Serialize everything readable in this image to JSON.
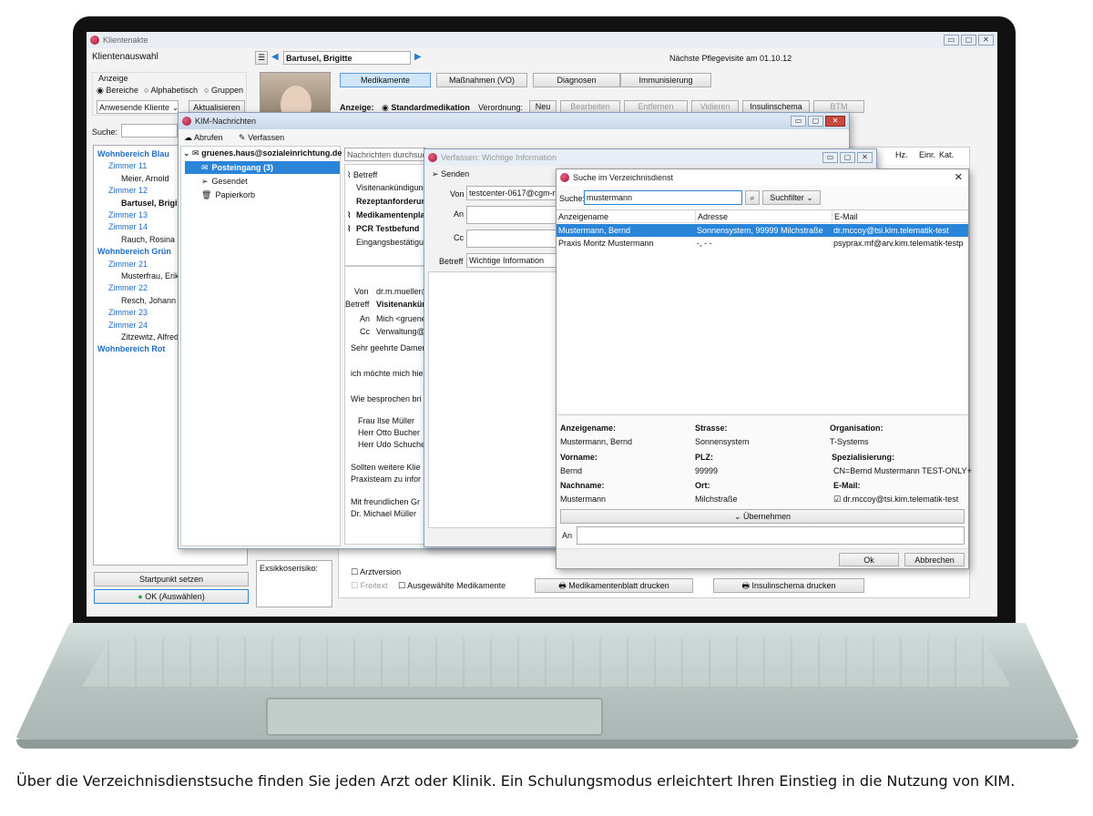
{
  "caption": "Über die Verzeichnisdienstsuche finden Sie jeden Arzt oder Klinik. Ein Schulungsmodus erleichtert Ihren Einstieg in die Nutzung von KIM.",
  "main": {
    "title": "Klientenakte",
    "client_select_label": "Klientenauswahl",
    "client_name": "Bartusel, Brigitte",
    "next_visit": "Nächste Pflegevisite am 01.10.12",
    "anzeige_label": "Anzeige",
    "radio_bereiche": "Bereiche",
    "radio_alphabetisch": "Alphabetisch",
    "radio_gruppen": "Gruppen",
    "filter_value": "Anwesende Kliente",
    "refresh_label": "Aktualisieren",
    "search_label": "Suche:",
    "tree": [
      {
        "text": "Wohnbereich Blau",
        "level": 0
      },
      {
        "text": "Zimmer 11",
        "level": 1
      },
      {
        "text": "Meier, Arnold",
        "level": 2
      },
      {
        "text": "Zimmer 12",
        "level": 1
      },
      {
        "text": "Bartusel, Brigitte",
        "level": 2,
        "bold": true
      },
      {
        "text": "Zimmer 13",
        "level": 1
      },
      {
        "text": "Zimmer 14",
        "level": 1
      },
      {
        "text": "Rauch, Rosina",
        "level": 2
      },
      {
        "text": "Wohnbereich Grün",
        "level": 0
      },
      {
        "text": "Zimmer 21",
        "level": 1
      },
      {
        "text": "Musterfrau, Erika",
        "level": 2
      },
      {
        "text": "Zimmer 22",
        "level": 1
      },
      {
        "text": "Resch, Johann",
        "level": 2
      },
      {
        "text": "Zimmer 23",
        "level": 1
      },
      {
        "text": "Zimmer 24",
        "level": 1
      },
      {
        "text": "Zitzewitz, Alfred",
        "level": 2
      },
      {
        "text": "Wohnbereich Rot",
        "level": 0
      }
    ],
    "startpunkt": "Startpunkt setzen",
    "ok_select": "OK (Auswählen)",
    "tabs": [
      "Medikamente",
      "Maßnahmen (VO)",
      "Diagnosen",
      "Immunisierung"
    ],
    "anzeige_row_label": "Anzeige:",
    "standardmedikation": "Standardmedikation",
    "verordnung_label": "Verordnung:",
    "action_buttons": [
      "Neu",
      "Bearbeiten",
      "Entfernen",
      "Vidieren",
      "Insulinschema",
      "BTM"
    ],
    "col_hz": "Hz.",
    "col_einr": "Einr.",
    "col_kat": "Kat.",
    "exsikkose": "Exsikkoserisiko:",
    "arztversion": "Arztversion",
    "freitext": "Freitext",
    "ausgewaehlte": "Ausgewählte Medikamente",
    "medikamentenblatt": "Medikamentenblatt drucken",
    "insulinschema_drucken": "Insulinschema drucken"
  },
  "kim": {
    "title": "KIM-Nachrichten",
    "abrufen": "Abrufen",
    "verfassen": "Verfassen",
    "account": "gruenes.haus@sozialeinrichtung.de",
    "folders": [
      "Posteingang (3)",
      "Gesendet",
      "Papierkorb"
    ],
    "search_placeholder": "Nachrichten durchsuchen",
    "list_header": "Betreff",
    "messages": [
      {
        "text": "Visitenankündigung",
        "bold": false,
        "attach": false
      },
      {
        "text": "Rezeptanforderung",
        "bold": true,
        "attach": false
      },
      {
        "text": "Medikamentenplan",
        "bold": true,
        "attach": true
      },
      {
        "text": "PCR Testbefund",
        "bold": true,
        "attach": true
      },
      {
        "text": "Eingangsbestätigung",
        "bold": false,
        "attach": false
      }
    ],
    "detail_von_label": "Von",
    "detail_von": "dr.m.mueller@",
    "detail_betreff_label": "Betreff",
    "detail_betreff": "Visitenankündigung",
    "detail_an_label": "An",
    "detail_an": "Mich <gruenes",
    "detail_cc_label": "Cc",
    "detail_cc": "Verwaltung@s",
    "body": [
      "Sehr geehrte Damen",
      "ich möchte mich hie",
      "Wie besprochen bri",
      "Frau Ilse Müller",
      "Herr Otto Bucher",
      "Herr Udo Schuche",
      "Sollten weitere Klie",
      "Praxisteam zu infor",
      "Mit freundlichen Gr",
      "Dr. Michael Müller"
    ]
  },
  "compose": {
    "title": "Verfassen: Wichtige Information",
    "senden": "Senden",
    "von_label": "Von",
    "von_value": "testcenter-0617@cgm-r",
    "an_label": "An",
    "cc_label": "Cc",
    "betreff_label": "Betreff",
    "betreff_value": "Wichtige Information"
  },
  "directory": {
    "title": "Suche im Verzeichnisdienst",
    "search_label": "Suche:",
    "search_value": "mustermann",
    "filter_label": "Suchfilter",
    "columns": [
      "Anzeigename",
      "Adresse",
      "E-Mail"
    ],
    "rows": [
      {
        "name": "Mustermann, Bernd",
        "address": "Sonnensystem, 99999 Milchstraße",
        "email": "dr.mccoy@tsi.kim.telematik-test",
        "selected": true
      },
      {
        "name": "Praxis Moritz Mustermann",
        "address": "-, - -",
        "email": "psyprax.mf@arv.kim.telematik-testp",
        "selected": false
      }
    ],
    "details": {
      "anzeigename_label": "Anzeigename:",
      "anzeigename": "Mustermann, Bernd",
      "strasse_label": "Strasse:",
      "strasse": "Sonnensystem",
      "organisation_label": "Organisation:",
      "organisation": "T-Systems",
      "vorname_label": "Vorname:",
      "vorname": "Bernd",
      "plz_label": "PLZ:",
      "plz": "99999",
      "spezialisierung_label": "Spezialisierung:",
      "spezialisierung": "CN=Bernd Mustermann TEST-ONLY+",
      "nachname_label": "Nachname:",
      "nachname": "Mustermann",
      "ort_label": "Ort:",
      "ort": "Milchstraße",
      "email_label": "E-Mail:",
      "email": "dr.mccoy@tsi.kim.telematik-test"
    },
    "uebernehmen": "Übernehmen",
    "an_label": "An",
    "ok": "Ok",
    "abbrechen": "Abbrechen"
  }
}
